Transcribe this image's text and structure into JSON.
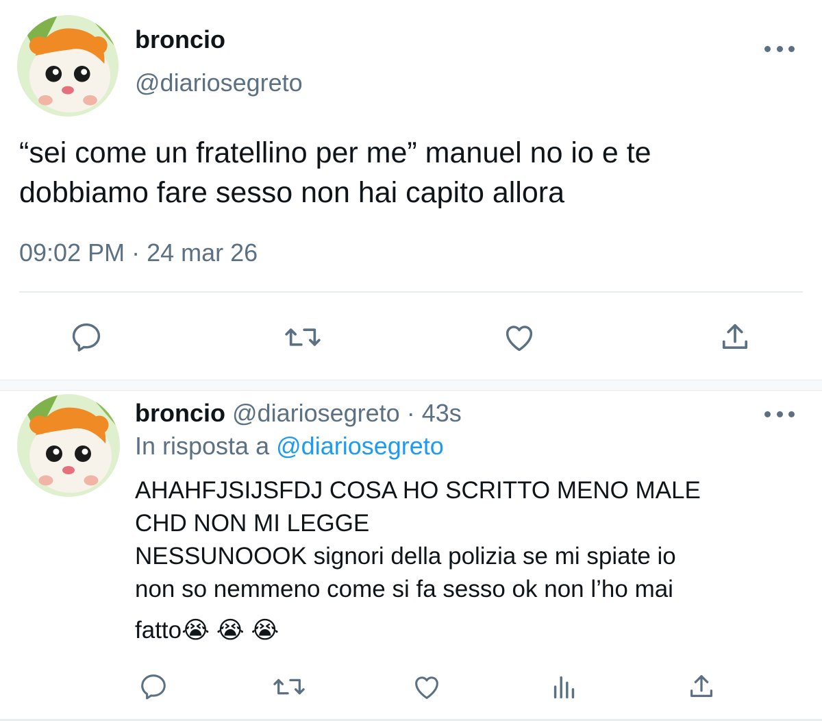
{
  "main_tweet": {
    "display_name": "broncio",
    "handle": "@diariosegreto",
    "text_line1": "“sei come un fratellino per me” manuel no io e te",
    "text_line2": "dobbiamo fare sesso non hai capito allora",
    "timestamp": "09:02 PM · 24 mar 26",
    "actions": [
      "reply-icon",
      "retweet-icon",
      "like-icon",
      "share-icon"
    ]
  },
  "reply_tweet": {
    "display_name": "broncio",
    "handle": "@diariosegreto",
    "separator": "·",
    "time": "43s",
    "in_reply_prefix": "In risposta a",
    "in_reply_handle": "@diariosegreto",
    "text_line1": "AHAHFJSIJSFDJ COSA HO SCRITTO MENO MALE",
    "text_line2": "CHD NON MI LEGGE",
    "text_line3": "NESSUNOOOK signori della polizia se mi spiate io",
    "text_line4": "non so nemmeno come si fa sesso ok non l’ho mai",
    "text_line5": "fatto",
    "emojis": [
      "😭",
      "😭",
      "😭"
    ],
    "actions": [
      "reply-icon",
      "retweet-icon",
      "like-icon",
      "analytics-icon",
      "share-icon"
    ]
  },
  "colors": {
    "text": "#0f1419",
    "muted": "#5b7083",
    "link": "#1d9bf0",
    "divider": "#e6ecf0"
  }
}
